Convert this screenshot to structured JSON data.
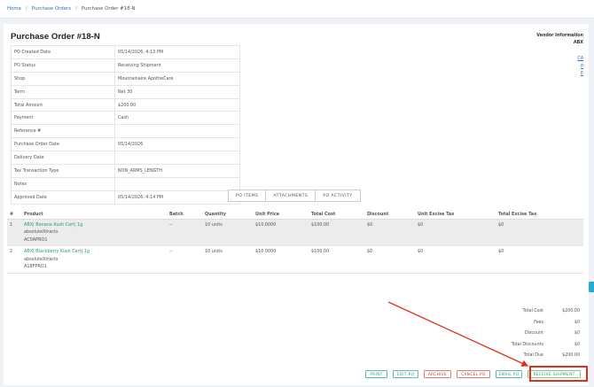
{
  "breadcrumb": {
    "home": "Home",
    "purchase_orders": "Purchase Orders",
    "current": "Purchase Order #18-N"
  },
  "page_title": "Purchase Order #18-N",
  "vendor": {
    "title": "Vendor Information",
    "name": "ABX",
    "links": [
      "CA",
      "P",
      "E"
    ]
  },
  "info": [
    {
      "label": "PO Created Date",
      "value": "05/14/2026, 4:13 PM"
    },
    {
      "label": "PO Status",
      "value": "Receiving Shipment"
    },
    {
      "label": "Shop",
      "value": "Mountainaire ApotheCare"
    },
    {
      "label": "Term",
      "value": "Net 30"
    },
    {
      "label": "Total Amount",
      "value": "$200.00"
    },
    {
      "label": "Payment",
      "value": "Cash"
    },
    {
      "label": "Reference #",
      "value": ""
    },
    {
      "label": "Purchase Order Date",
      "value": "05/14/2026"
    },
    {
      "label": "Delivery Date",
      "value": ""
    },
    {
      "label": "Tax Transaction Type",
      "value": "NON_ARMS_LENGTH"
    },
    {
      "label": "Notes",
      "value": ""
    },
    {
      "label": "Approved Date",
      "value": "05/14/2026, 4:14 PM"
    }
  ],
  "tabs": [
    "PO ITEMS",
    "ATTACHMENTS",
    "PO ACTIVITY"
  ],
  "items_table": {
    "headers": [
      "#",
      "Product",
      "Batch",
      "Quantity",
      "Unit Price",
      "Total Cost",
      "Discount",
      "Unit Excise Tax",
      "Total Excise Tax"
    ],
    "rows": [
      {
        "num": "1",
        "product": "ABX| Banana Kush Cart| 1g",
        "brand": "absoluteXtracts",
        "sku": "AC0APRO1",
        "batch": "--",
        "quantity": "10 units",
        "unit_price": "$10.0000",
        "total_cost": "$100.00",
        "discount": "$0",
        "unit_excise": "$0",
        "total_excise": "$0"
      },
      {
        "num": "2",
        "product": "ABX| Blackberry Kush Cart| 1g",
        "brand": "absoluteXtracts",
        "sku": "A18FPRO1",
        "batch": "--",
        "quantity": "10 units",
        "unit_price": "$10.0000",
        "total_cost": "$100.00",
        "discount": "$0",
        "unit_excise": "$0",
        "total_excise": "$0"
      }
    ]
  },
  "totals": [
    {
      "label": "Total Cost",
      "value": "$200.00"
    },
    {
      "label": "Fees",
      "value": "$0"
    },
    {
      "label": "Discount",
      "value": "$0"
    },
    {
      "label": "Total Discounts",
      "value": "$0"
    },
    {
      "label": "Total Due",
      "value": "$200.00"
    }
  ],
  "actions": {
    "print": "PRINT",
    "edit": "EDIT PO",
    "archive": "ARCHIVE",
    "cancel": "CANCEL PO",
    "email": "EMAIL PO",
    "receive": "RECEIVE SHIPMENT"
  },
  "colors": {
    "link": "#2a6fb5",
    "product_link": "#2a9a6e",
    "annotation_red": "#e32d1e",
    "teal_button": "#2a9a8e",
    "red_button": "#c0392b"
  }
}
